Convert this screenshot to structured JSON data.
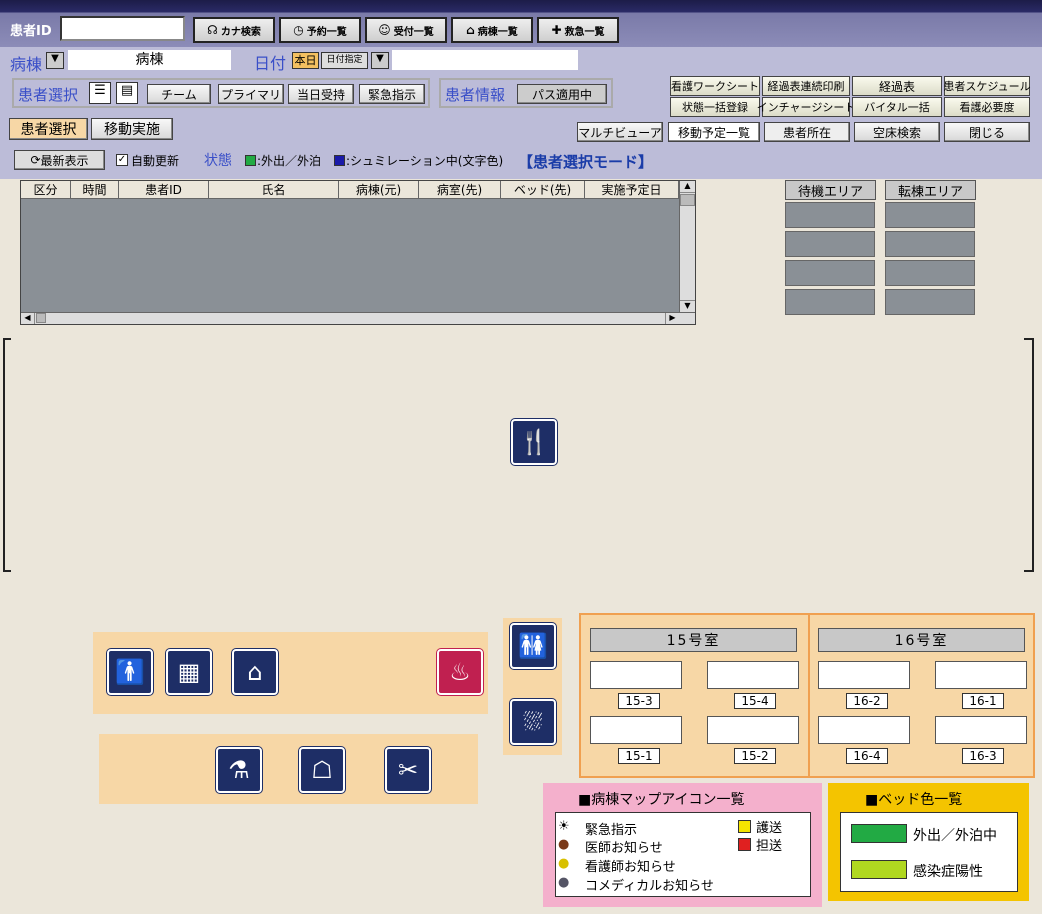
{
  "header": {
    "patient_id_label": "患者ID",
    "patient_id_value": "",
    "buttons": [
      {
        "label": "カナ検索",
        "icon": "kana-search-icon",
        "glyph": "☊"
      },
      {
        "label": "予約一覧",
        "icon": "clock-icon",
        "glyph": "◷"
      },
      {
        "label": "受付一覧",
        "icon": "person-icon",
        "glyph": "☺"
      },
      {
        "label": "病棟一覧",
        "icon": "ward-icon",
        "glyph": "⌂"
      },
      {
        "label": "救急一覧",
        "icon": "ambulance-icon",
        "glyph": "✚"
      }
    ]
  },
  "ward": {
    "label": "病棟",
    "value": "病棟",
    "date_label": "日付",
    "today": "本日",
    "date_spec": "日付指定",
    "date_value": ""
  },
  "patient_select": {
    "label": "患者選択",
    "team": "チーム",
    "primary": "プライマリ",
    "same_day": "当日受持",
    "urgent": "緊急指示"
  },
  "patient_info": {
    "label": "患者情報",
    "path": "パス適用中"
  },
  "right_buttons": [
    [
      "看護ワークシート",
      "経過表連続印刷",
      "経過表",
      "患者スケジュール"
    ],
    [
      "状態一括登録",
      "インチャージシート",
      "バイタル一括",
      "看護必要度"
    ]
  ],
  "modes": {
    "select": "患者選択",
    "move": "移動実施"
  },
  "bottom_buttons": [
    "マルチビューア",
    "移動予定一覧",
    "患者所在",
    "空床検索",
    "閉じる"
  ],
  "status_bar": {
    "refresh": "最新表示",
    "auto_update": "自動更新",
    "status_label": "状態",
    "out": ":外出／外泊",
    "sim": ":シュミレーション中(文字色)",
    "mode": "【患者選択モード】"
  },
  "table": {
    "columns": [
      "区分",
      "時間",
      "患者ID",
      "氏名",
      "病棟(元)",
      "病室(先)",
      "ベッド(先)",
      "実施予定日"
    ]
  },
  "areas": {
    "waiting": "待機エリア",
    "transfer": "転棟エリア"
  },
  "rooms": [
    {
      "title": "15号室",
      "beds": [
        "15-3",
        "15-4",
        "15-1",
        "15-2"
      ]
    },
    {
      "title": "16号室",
      "beds": [
        "16-2",
        "16-1",
        "16-4",
        "16-3"
      ]
    }
  ],
  "icon_legend": {
    "title": "■病棟マップアイコン一覧",
    "items": [
      "緊急指示",
      "医師お知らせ",
      "看護師お知らせ",
      "コメディカルお知らせ"
    ],
    "transport": [
      "護送",
      "担送"
    ]
  },
  "bed_colors": {
    "title": "■ベッド色一覧",
    "items": [
      {
        "label": "外出／外泊中",
        "color": "#22aa44"
      },
      {
        "label": "感染症陽性",
        "color": "#b0d820"
      }
    ]
  },
  "colors": {
    "accent": "#3a4fc8",
    "panel": "#f7d7a6",
    "map_icon": "#1e2e66"
  }
}
